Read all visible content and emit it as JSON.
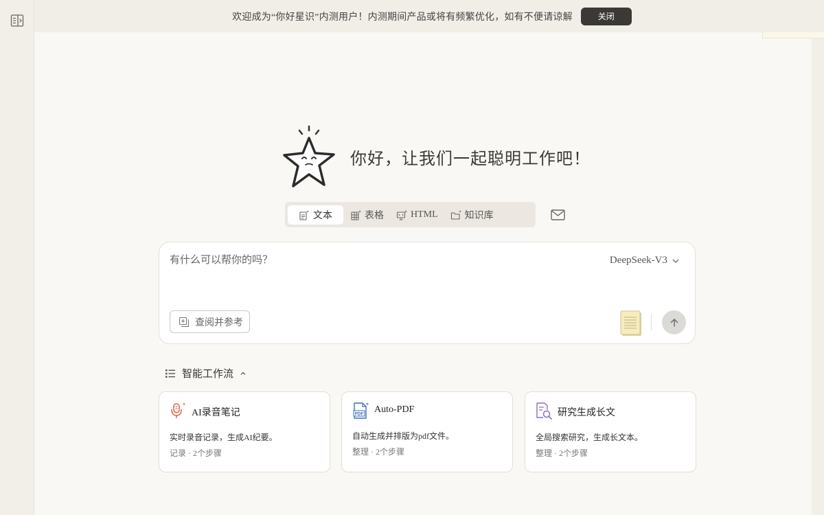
{
  "banner": {
    "message": "欢迎成为“你好星识”内测用户！内测期间产品或将有频繁优化，如有不便请谅解",
    "close_label": "关闭"
  },
  "hero": {
    "greeting": "你好，让我们一起聪明工作吧！"
  },
  "modes": [
    {
      "label": "文本",
      "icon": "document-icon"
    },
    {
      "label": "表格",
      "icon": "table-icon"
    },
    {
      "label": "HTML",
      "icon": "html-icon"
    },
    {
      "label": "知识库",
      "icon": "folder-icon"
    }
  ],
  "composer": {
    "placeholder": "有什么可以帮你的吗？",
    "model": "DeepSeek-V3",
    "reference_label": "查阅并参考"
  },
  "workflows": {
    "title": "智能工作流",
    "cards": [
      {
        "title": "AI录音笔记",
        "description": "实时录音记录，生成AI纪要。",
        "meta": "记录 · 2个步骤",
        "icon": "microphone-icon"
      },
      {
        "title": "Auto-PDF",
        "description": "自动生成并排版为pdf文件。",
        "meta": "整理 · 2个步骤",
        "icon": "pdf-icon"
      },
      {
        "title": "研究生成长文",
        "description": "全局搜索研究，生成长文本。",
        "meta": "整理 · 2个步骤",
        "icon": "search-document-icon"
      }
    ]
  },
  "colors": {
    "background": "#faf8f4",
    "sidebar": "#f2efe9",
    "close_button": "#3b3936",
    "mic_accent": "#d66a4a",
    "pdf_accent": "#3f6fb5",
    "research_accent": "#8a6cc8"
  }
}
